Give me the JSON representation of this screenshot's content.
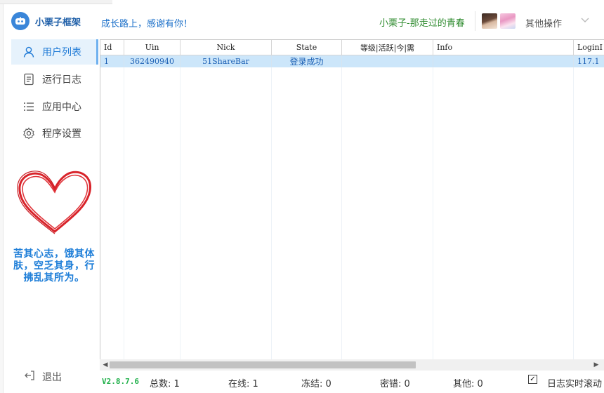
{
  "app": {
    "logo_text": "小栗子框架",
    "slogan": "成长路上，感谢有你！",
    "user_name": "小栗子-那走过的青春",
    "other_ops_label": "其他操作"
  },
  "sidebar": {
    "items": [
      {
        "label": "用户列表",
        "icon": "user-icon",
        "active": true
      },
      {
        "label": "运行日志",
        "icon": "document-icon",
        "active": false
      },
      {
        "label": "应用中心",
        "icon": "list-icon",
        "active": false
      },
      {
        "label": "程序设置",
        "icon": "gear-icon",
        "active": false
      }
    ],
    "motto": "苦其心志，饿其体肤，空乏其身，行拂乱其所为。",
    "logout_label": "退出"
  },
  "table": {
    "columns": [
      "Id",
      "Uin",
      "Nick",
      "State",
      "等级|活跃|今|需",
      "Info",
      "LoginI"
    ],
    "rows": [
      [
        "1",
        "362490940",
        "51ShareBar",
        "登录成功",
        "",
        "",
        "117.1"
      ]
    ]
  },
  "status": {
    "version": "V2.8.7.6",
    "total": "总数: 1",
    "online": "在线: 1",
    "frozen": "冻结: 0",
    "pwd_error": "密错: 0",
    "other": "其他: 0",
    "log_scroll_label": "日志实时滚动",
    "log_scroll_checked": true
  },
  "colors": {
    "accent": "#1f7ad6",
    "active_bg": "#e6f2fc",
    "selected_row": "#cce6fa",
    "online_green": "#2e8b2e",
    "version_green": "#22b14c",
    "motto_blue": "#1e7ed8"
  }
}
